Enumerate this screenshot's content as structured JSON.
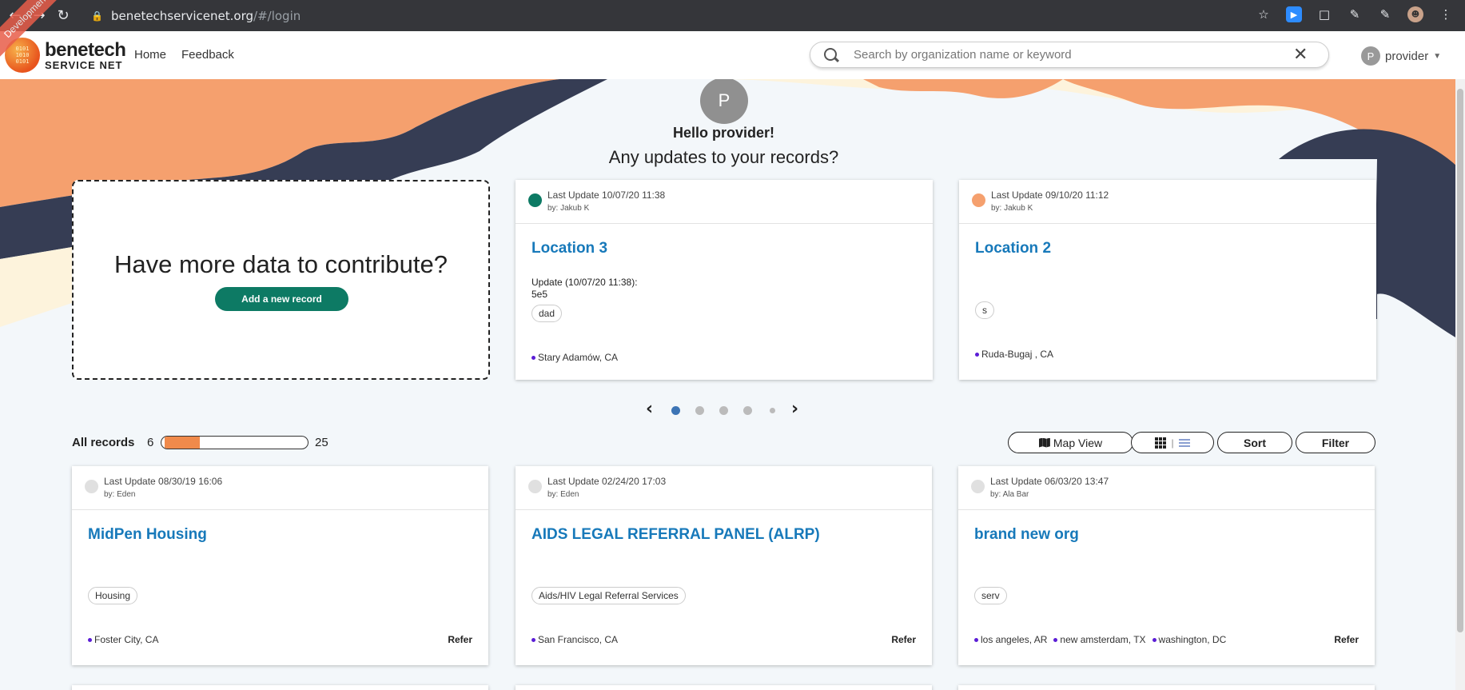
{
  "browser": {
    "url_host": "benetechservicenet.org",
    "url_path": "/#/login"
  },
  "header": {
    "logo_line1": "benetech",
    "logo_line2": "SERVICE NET",
    "dev_ribbon": "Development",
    "nav": [
      {
        "label": "Home"
      },
      {
        "label": "Feedback"
      }
    ],
    "search_placeholder": "Search by organization name or keyword",
    "user_initial": "P",
    "user_name": "provider"
  },
  "hero": {
    "avatar_initial": "P",
    "greeting": "Hello provider!",
    "question": "Any updates to your records?"
  },
  "contribute": {
    "title": "Have more data to contribute?",
    "button": "Add a new record"
  },
  "recent_cards": [
    {
      "status_color": "#0d7a64",
      "last_update": "Last Update 10/07/20 11:38",
      "by": "by: Jakub K",
      "title": "Location 3",
      "update_line1": "Update (10/07/20 11:38):",
      "update_line2": "5e5",
      "tag": "dad",
      "locations": [
        "Stary Adamów, CA"
      ]
    },
    {
      "status_color": "#f5a06e",
      "last_update": "Last Update 09/10/20 11:12",
      "by": "by: Jakub K",
      "title": "Location 2",
      "tag": "s",
      "locations": [
        "Ruda-Bugaj , CA"
      ]
    }
  ],
  "carousel": {
    "pages": 5,
    "active": 0
  },
  "records": {
    "label": "All records",
    "count": "6",
    "total": "25",
    "progress_fraction": 0.24,
    "buttons": {
      "map_view": "Map View",
      "sort": "Sort",
      "filter": "Filter"
    }
  },
  "record_cards": [
    {
      "status_color": "#e0e0e0",
      "last_update": "Last Update 08/30/19 16:06",
      "by": "by: Eden",
      "title": "MidPen Housing",
      "tag": "Housing",
      "locations": [
        "Foster City, CA"
      ],
      "refer": "Refer"
    },
    {
      "status_color": "#e0e0e0",
      "last_update": "Last Update 02/24/20 17:03",
      "by": "by: Eden",
      "title": "AIDS LEGAL REFERRAL PANEL (ALRP)",
      "tag": "Aids/HIV Legal Referral Services",
      "locations": [
        "San Francisco, CA"
      ],
      "refer": "Refer"
    },
    {
      "status_color": "#e0e0e0",
      "last_update": "Last Update 06/03/20 13:47",
      "by": "by: Ala Bar",
      "title": "brand new org",
      "tag": "serv",
      "locations": [
        "los angeles, AR",
        "new amsterdam, TX",
        "washington, DC"
      ],
      "refer": "Refer"
    }
  ]
}
